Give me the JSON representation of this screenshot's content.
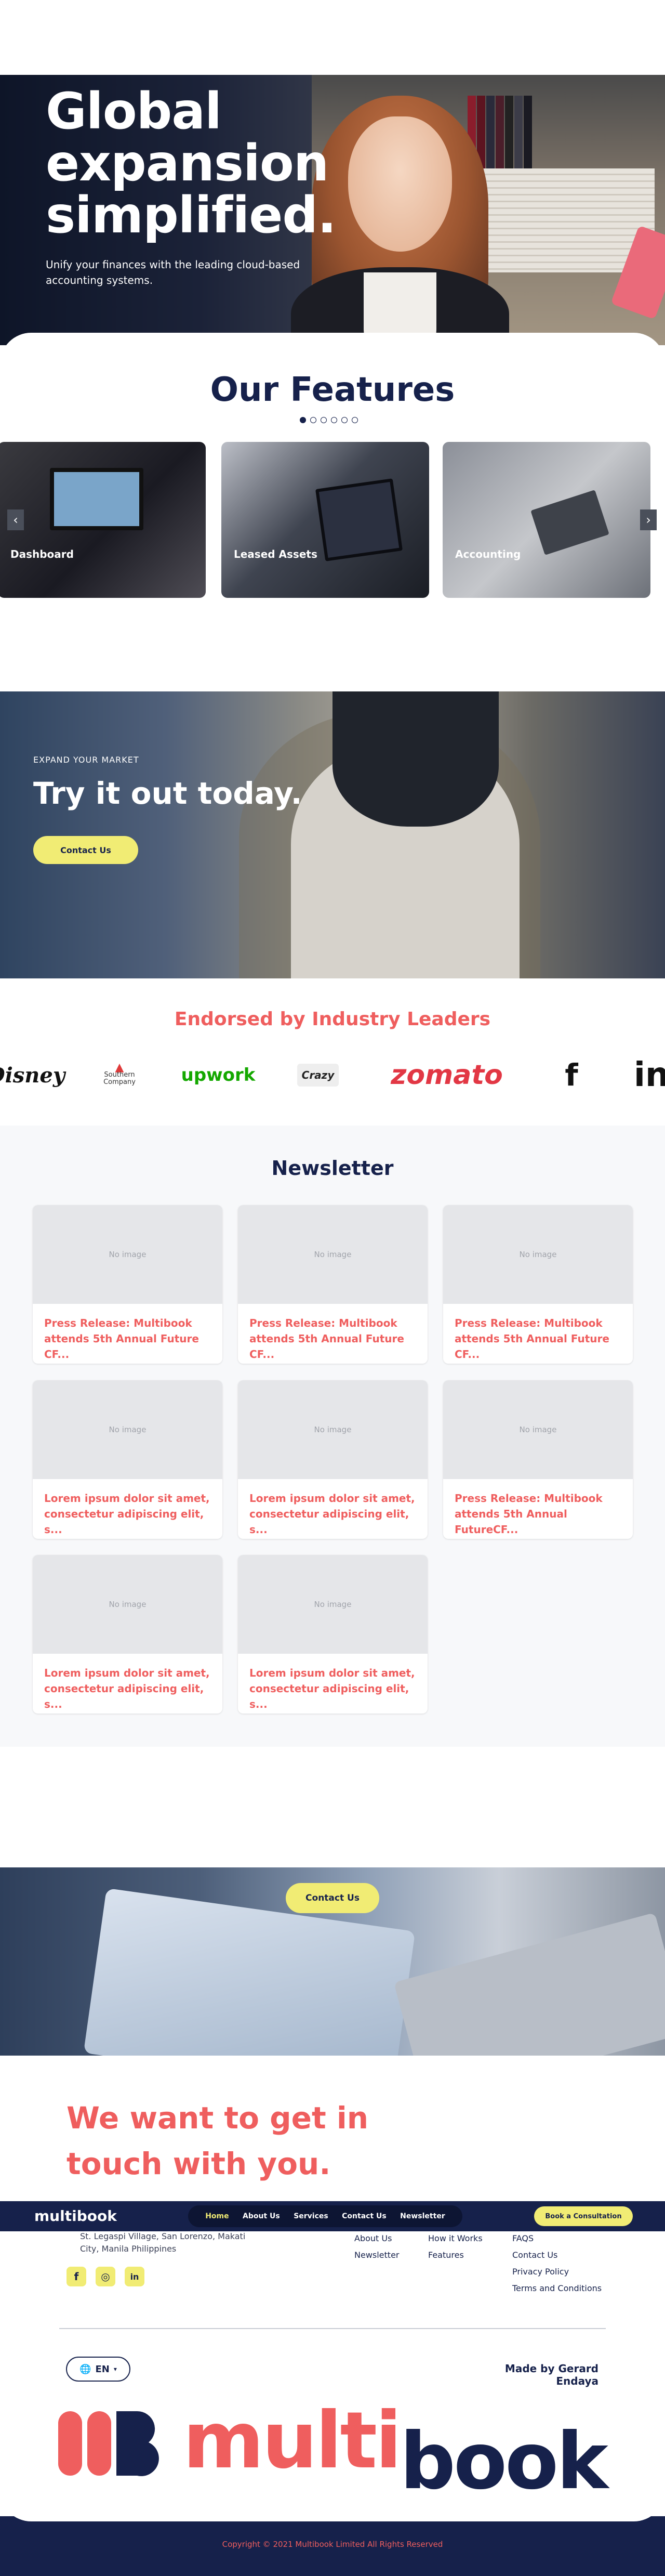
{
  "hero": {
    "title": "Global expansion simplified.",
    "subtitle": "Unify your finances with the leading cloud-based accounting systems."
  },
  "features": {
    "title": "Our Features",
    "cards": [
      {
        "label": "Dashboard"
      },
      {
        "label": "Leased Assets"
      },
      {
        "label": "Accounting"
      }
    ],
    "prev_icon": "chevron-left-icon",
    "next_icon": "chevron-right-icon",
    "dots_count": 6,
    "active_dot": 1
  },
  "try_section": {
    "kicker": "EXPAND YOUR MARKET",
    "title": "Try it out today.",
    "button": "Contact Us"
  },
  "endorsed": {
    "title": "Endorsed by Industry Leaders",
    "logos": [
      {
        "name": "Disney",
        "text": "Disney"
      },
      {
        "name": "Southern Company",
        "text": "Southern Company"
      },
      {
        "name": "Upwork",
        "text": "upwork"
      },
      {
        "name": "Crazy",
        "text": "Crazy"
      },
      {
        "name": "Zomato",
        "text": "zomato"
      },
      {
        "name": "Facebook",
        "text": "f"
      },
      {
        "name": "LinkedIn",
        "text": "in"
      }
    ]
  },
  "newsletter": {
    "title": "Newsletter",
    "no_image": "No image",
    "items": [
      {
        "title": "Press Release: Multibook attends 5th Annual Future CF..."
      },
      {
        "title": "Press Release: Multibook attends 5th Annual Future CF..."
      },
      {
        "title": "Press Release: Multibook attends 5th Annual Future CF..."
      },
      {
        "title": "Lorem ipsum dolor sit amet, consectetur adipiscing elit, s..."
      },
      {
        "title": "Lorem ipsum dolor sit amet, consectetur adipiscing elit, s..."
      },
      {
        "title": "Press Release: Multibook attends 5th Annual FutureCF..."
      },
      {
        "title": "Lorem ipsum dolor sit amet, consectetur adipiscing elit, s..."
      },
      {
        "title": "Lorem ipsum dolor sit amet, consectetur adipiscing elit, s..."
      }
    ]
  },
  "contact": {
    "button": "Contact Us",
    "title": "We want to get in touch with you."
  },
  "navbar": {
    "brand": "multibook",
    "links": [
      "Home",
      "About Us",
      "Services",
      "Contact Us",
      "Newsletter"
    ],
    "active": "Home",
    "cta": "Book a Consultation"
  },
  "footer": {
    "address": "St. Legaspi Village, San Lorenzo, Makati City, Manila Philippines",
    "socials": [
      {
        "icon": "facebook-icon",
        "glyph": "f"
      },
      {
        "icon": "instagram-icon",
        "glyph": "◎"
      },
      {
        "icon": "linkedin-icon",
        "glyph": "in"
      }
    ],
    "col1": [
      "About Us",
      "Newsletter"
    ],
    "col2": [
      "How it Works",
      "Features"
    ],
    "col3": [
      "FAQS",
      "Contact Us",
      "Privacy Policy",
      "Terms and Conditions"
    ],
    "lang": "EN",
    "made_by": "Made by Gerard Endaya",
    "logo_multi": "multi",
    "logo_book": "book",
    "copyright": "Copyright © 2021 Multibook Limited All Rights Reserved"
  },
  "colors": {
    "navy": "#16214b",
    "coral": "#ef5e5e",
    "yellow": "#f1ec74"
  }
}
